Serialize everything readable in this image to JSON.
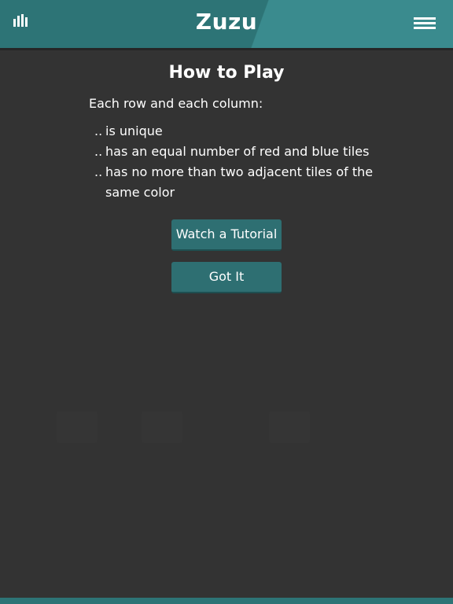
{
  "header": {
    "title": "Zuzu",
    "stats_icon": "bar-chart-icon",
    "menu_icon": "hamburger-menu-icon",
    "color_primary": "#2d7476",
    "color_secondary": "#3a8b8e"
  },
  "howto": {
    "title": "How to Play",
    "intro": "Each row and each column:",
    "rules": [
      {
        "prefix": "..",
        "text": "is unique"
      },
      {
        "prefix": "..",
        "text": "has an equal number of red and blue tiles"
      },
      {
        "prefix": "..",
        "text": "has no more than two adjacent tiles of the same color"
      }
    ]
  },
  "buttons": {
    "tutorial_label": "Watch a Tutorial",
    "gotit_label": "Got It",
    "color": "#2e6f72"
  },
  "theme": {
    "background": "#333333"
  }
}
